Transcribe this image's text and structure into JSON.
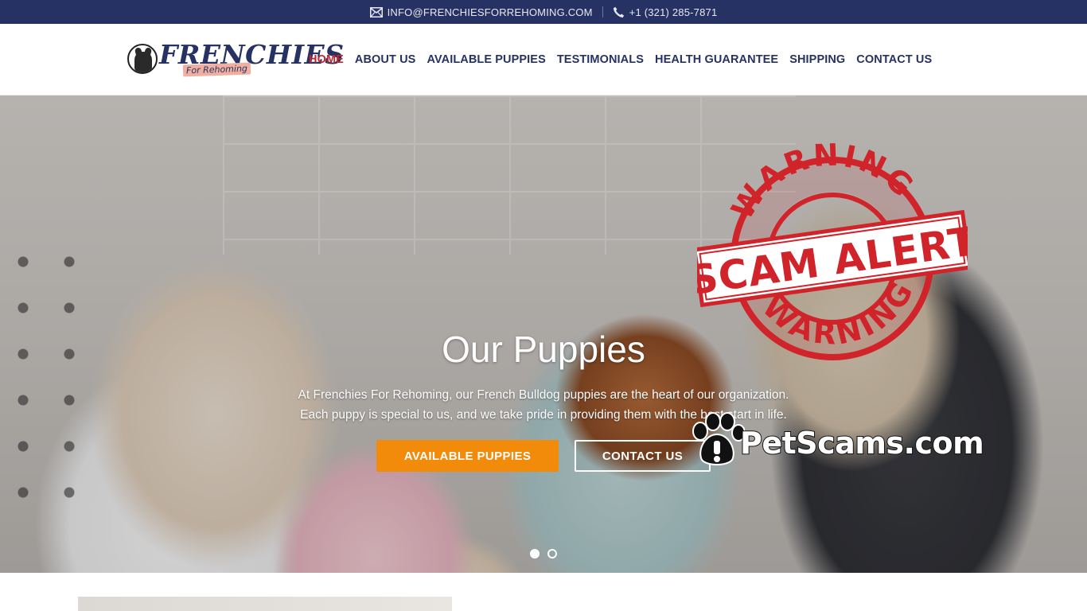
{
  "topbar": {
    "email": "INFO@FRENCHIESFORREHOMING.COM",
    "phone": "+1 (321) 285-7871",
    "email_icon": "envelope-icon",
    "phone_icon": "phone-icon"
  },
  "header": {
    "logo_word": "FRENCHIES",
    "logo_tag": "For Rehoming",
    "nav": [
      {
        "label": "HOME",
        "active": true
      },
      {
        "label": "ABOUT US"
      },
      {
        "label": "AVAILABLE PUPPIES"
      },
      {
        "label": "TESTIMONIALS"
      },
      {
        "label": "HEALTH GUARANTEE"
      },
      {
        "label": "SHIPPING"
      },
      {
        "label": "CONTACT US"
      }
    ]
  },
  "hero": {
    "title": "Our Puppies",
    "line1": "At Frenchies For Rehoming, our French Bulldog puppies are the heart of our organization.",
    "line2": "Each puppy is special to us, and we take pride in providing them with the best start in life.",
    "btn_primary": "AVAILABLE PUPPIES",
    "btn_secondary": "CONTACT US",
    "slides": 2,
    "active_slide": 1
  },
  "overlay": {
    "stamp_top": "WARNING",
    "stamp_middle": "SCAM ALERT",
    "stamp_bottom": "WARNING",
    "site": "PetScams.com"
  },
  "colors": {
    "topbar": "#263264",
    "nav_text": "#263264",
    "nav_active": "#c4252b",
    "button_primary": "#f28a0a",
    "stamp_red": "#d0232a"
  }
}
